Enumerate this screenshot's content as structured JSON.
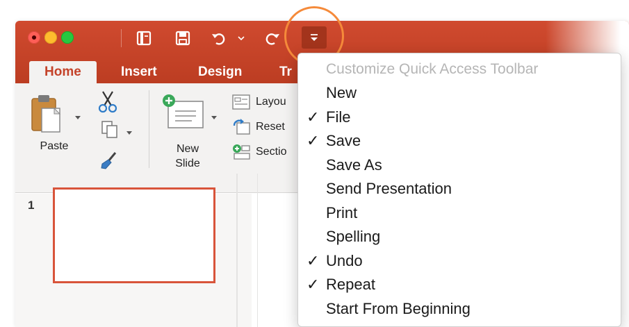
{
  "titlebar": {
    "tabs": [
      {
        "label": "Home",
        "active": true
      },
      {
        "label": "Insert"
      },
      {
        "label": "Design"
      },
      {
        "label": "Tr"
      }
    ]
  },
  "ribbon": {
    "paste_label": "Paste",
    "new_slide_label_line1": "New",
    "new_slide_label_line2": "Slide",
    "layout_label": "Layou",
    "reset_label": "Reset",
    "section_label": "Sectio"
  },
  "slides": {
    "first_number": "1"
  },
  "menu": {
    "header": "Customize Quick Access Toolbar",
    "items": [
      {
        "label": "New",
        "checked": false
      },
      {
        "label": "File",
        "checked": true
      },
      {
        "label": "Save",
        "checked": true
      },
      {
        "label": "Save As",
        "checked": false
      },
      {
        "label": "Send Presentation",
        "checked": false
      },
      {
        "label": "Print",
        "checked": false
      },
      {
        "label": "Spelling",
        "checked": false
      },
      {
        "label": "Undo",
        "checked": true
      },
      {
        "label": "Repeat",
        "checked": true
      },
      {
        "label": "Start From Beginning",
        "checked": false
      }
    ],
    "check_glyph": "✓"
  },
  "colors": {
    "titlebar": "#c4432a",
    "highlight_ring": "#f58a3a",
    "slide_border": "#d8543a"
  }
}
